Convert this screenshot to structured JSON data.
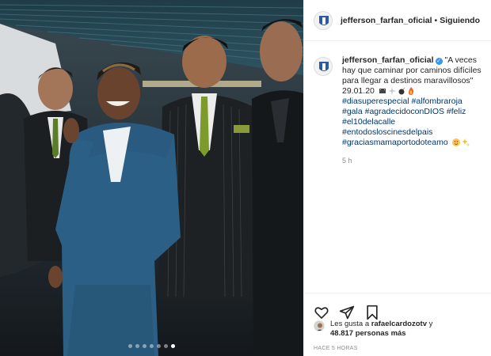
{
  "header": {
    "username": "jefferson_farfan_oficial",
    "separator": "•",
    "follow_status": "Siguiendo"
  },
  "post": {
    "username": "jefferson_farfan_oficial",
    "verified_icon": "verified-badge-icon",
    "text": "\"A veces hay que caminar por caminos difíciles para llegar a destinos maravillosos\"",
    "date": "29.01.20",
    "hashtags": [
      "#diasuperespecial #alfombraroja",
      "#gala #agradecidoconDIOS #feliz",
      "#el10delacalle",
      "#entodosloscinesdelpais",
      "#graciasmamaportodoteamo"
    ],
    "time_ago": "5 h"
  },
  "likes": {
    "prefix": "Les gusta a",
    "user": "rafaelcardozotv",
    "connector": "y",
    "count": "48.817 personas más"
  },
  "posted_label": "HACE 5 HORAS",
  "carousel": {
    "total": 7,
    "active_index": 6
  },
  "colors": {
    "link": "#00376b",
    "verified": "#3897f0",
    "muted": "#8e8e8e"
  }
}
